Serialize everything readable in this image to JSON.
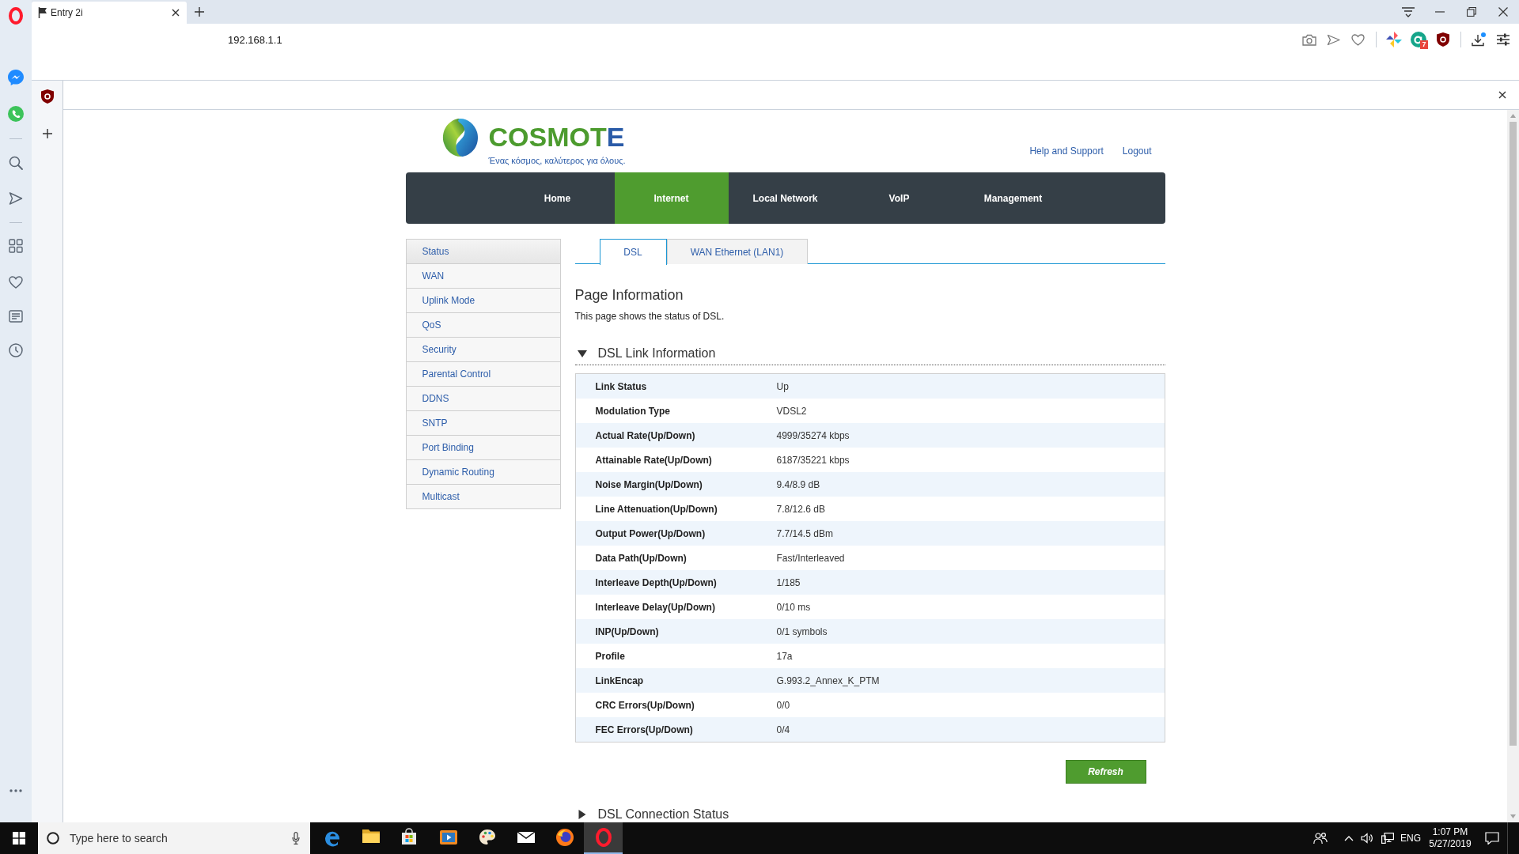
{
  "browser": {
    "tab_title": "Entry 2i",
    "address": "192.168.1.1",
    "extension_badge": "7"
  },
  "header": {
    "wordmark": "COSMOTE",
    "tagline": "Ένας κόσμος, καλύτερος για όλους.",
    "links": [
      "Help and Support",
      "Logout"
    ]
  },
  "nav": [
    {
      "label": "Home",
      "selected": false
    },
    {
      "label": "Internet",
      "selected": true
    },
    {
      "label": "Local Network",
      "selected": false
    },
    {
      "label": "VoIP",
      "selected": false
    },
    {
      "label": "Management",
      "selected": false
    }
  ],
  "menu": [
    {
      "label": "Status",
      "selected": true
    },
    {
      "label": "WAN",
      "selected": false
    },
    {
      "label": "Uplink Mode",
      "selected": false
    },
    {
      "label": "QoS",
      "selected": false
    },
    {
      "label": "Security",
      "selected": false
    },
    {
      "label": "Parental Control",
      "selected": false
    },
    {
      "label": "DDNS",
      "selected": false
    },
    {
      "label": "SNTP",
      "selected": false
    },
    {
      "label": "Port Binding",
      "selected": false
    },
    {
      "label": "Dynamic Routing",
      "selected": false
    },
    {
      "label": "Multicast",
      "selected": false
    }
  ],
  "tabs": [
    {
      "label": "DSL",
      "selected": true
    },
    {
      "label": "WAN Ethernet (LAN1)",
      "selected": false
    }
  ],
  "page_info": {
    "title": "Page Information",
    "description": "This page shows the status of DSL."
  },
  "sections": [
    {
      "title": "DSL Link Information",
      "expanded": true,
      "rows": [
        {
          "label": "Link Status",
          "value": "Up"
        },
        {
          "label": "Modulation Type",
          "value": "VDSL2"
        },
        {
          "label": "Actual Rate(Up/Down)",
          "value": "4999/35274 kbps"
        },
        {
          "label": "Attainable Rate(Up/Down)",
          "value": "6187/35221 kbps"
        },
        {
          "label": "Noise Margin(Up/Down)",
          "value": "9.4/8.9 dB"
        },
        {
          "label": "Line Attenuation(Up/Down)",
          "value": "7.8/12.6 dB"
        },
        {
          "label": "Output Power(Up/Down)",
          "value": "7.7/14.5 dBm"
        },
        {
          "label": "Data Path(Up/Down)",
          "value": "Fast/Interleaved"
        },
        {
          "label": "Interleave Depth(Up/Down)",
          "value": "1/185"
        },
        {
          "label": "Interleave Delay(Up/Down)",
          "value": "0/10 ms"
        },
        {
          "label": "INP(Up/Down)",
          "value": "0/1 symbols"
        },
        {
          "label": "Profile",
          "value": "17a"
        },
        {
          "label": "LinkEncap",
          "value": "G.993.2_Annex_K_PTM"
        },
        {
          "label": "CRC Errors(Up/Down)",
          "value": "0/0"
        },
        {
          "label": "FEC Errors(Up/Down)",
          "value": "0/4"
        }
      ],
      "button": "Refresh"
    },
    {
      "title": "DSL Connection Status",
      "expanded": false
    }
  ],
  "taskbar": {
    "placeholder": "Type here to search",
    "apps": [
      {
        "kind": "edge",
        "active": false
      },
      {
        "kind": "explorer",
        "active": false
      },
      {
        "kind": "store",
        "active": false
      },
      {
        "kind": "media",
        "active": false
      },
      {
        "kind": "paint",
        "active": false
      },
      {
        "kind": "mail",
        "active": false
      },
      {
        "kind": "firefox",
        "active": false
      },
      {
        "kind": "opera",
        "active": true
      }
    ],
    "language": "ENG",
    "time": "1:07 PM",
    "date": "5/27/2019"
  }
}
